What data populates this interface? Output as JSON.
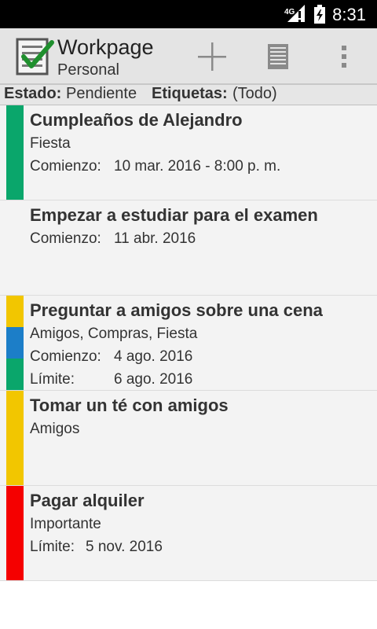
{
  "status_bar": {
    "network": "4G",
    "time": "8:31"
  },
  "app_bar": {
    "title": "Workpage",
    "subtitle": "Personal"
  },
  "filter": {
    "estado_label": "Estado:",
    "estado_value": "Pendiente",
    "etiquetas_label": "Etiquetas:",
    "etiquetas_value": "(Todo)"
  },
  "tasks": [
    {
      "title": "Cumpleaños de Alejandro",
      "tags": "Fiesta",
      "start_label": "Comienzo:",
      "start": "10 mar. 2016 - 8:00 p. m.",
      "colors": [
        "#0aa66b"
      ]
    },
    {
      "title": "Empezar a estudiar para el examen",
      "start_label": "Comienzo:",
      "start": "11 abr. 2016",
      "colors": []
    },
    {
      "title": "Preguntar a amigos sobre una cena",
      "tags": "Amigos, Compras, Fiesta",
      "start_label": "Comienzo:",
      "start": "4 ago. 2016",
      "due_label": "Límite:",
      "due": "6 ago. 2016",
      "colors": [
        "#f2c600",
        "#1c7ec8",
        "#0aa66b"
      ]
    },
    {
      "title": "Tomar un té con amigos",
      "tags": "Amigos",
      "colors": [
        "#f2c600"
      ]
    },
    {
      "title": "Pagar alquiler",
      "tags": "Importante",
      "due_label": "Límite:",
      "due": "5 nov. 2016",
      "colors": [
        "#f50000"
      ]
    }
  ]
}
